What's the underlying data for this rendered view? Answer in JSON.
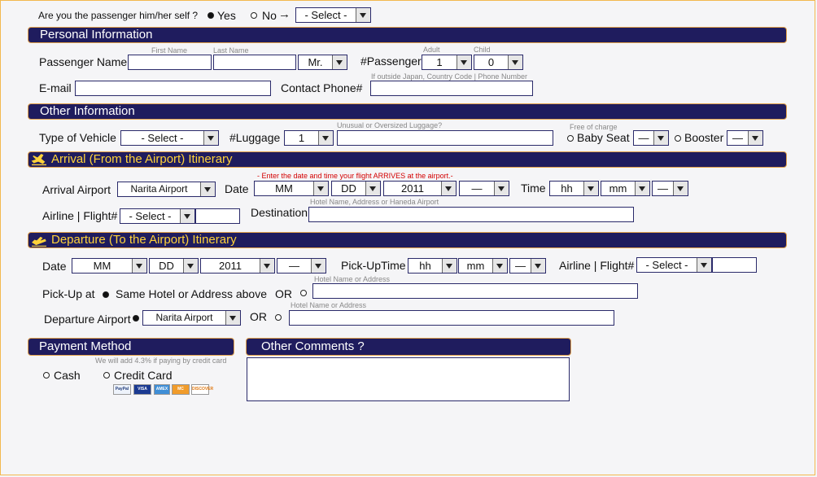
{
  "top": {
    "question": "Are you the passenger him/her self ?",
    "yes": "Yes",
    "no": "No",
    "arrow": "→",
    "select": "- Select -"
  },
  "personal": {
    "title": "Personal Information",
    "passenger_name": "Passenger Name",
    "first_name": "First Name",
    "last_name": "Last Name",
    "title_value": "Mr.",
    "num_passenger": "#Passenger",
    "adult": "Adult",
    "child": "Child",
    "adult_value": "1",
    "child_value": "0",
    "email": "E-mail",
    "contact_phone": "Contact Phone#",
    "phone_hint": "If outside Japan, Country Code | Phone Number"
  },
  "other": {
    "title": "Other Information",
    "type_vehicle": "Type of Vehicle",
    "vehicle_value": "- Select -",
    "luggage": "#Luggage",
    "luggage_value": "1",
    "luggage_hint": "Unusual or Oversized Luggage?",
    "free_charge": "Free of charge",
    "baby_seat": "Baby Seat",
    "booster": "Booster",
    "dash": "—"
  },
  "arrival": {
    "title": "Arrival (From the Airport) Itinerary",
    "airport_label": "Arrival Airport",
    "airport_value": "Narita Airport",
    "date": "Date",
    "warning": "- Enter the date and time your flight ARRIVES at the airport.-",
    "mm": "MM",
    "dd": "DD",
    "year": "2011",
    "dash": "—",
    "time": "Time",
    "hh": "hh",
    "min": "mm",
    "airline": "Airline | Flight#",
    "airline_value": "- Select -",
    "destination": "Destination",
    "dest_hint": "Hotel Name, Address or Haneda Airport"
  },
  "departure": {
    "title": "Departure (To the Airport) Itinerary",
    "date": "Date",
    "mm": "MM",
    "dd": "DD",
    "year": "2011",
    "dash": "—",
    "pickup_time": "Pick-UpTime",
    "hh": "hh",
    "min": "mm",
    "airline": "Airline | Flight#",
    "airline_value": "- Select -",
    "pickup_at": "Pick-Up at",
    "same_hotel": "Same Hotel or Address above",
    "or": "OR",
    "hotel_hint": "Hotel Name or Address",
    "dep_airport": "Departure Airport",
    "dep_airport_value": "Narita Airport"
  },
  "payment": {
    "title": "Payment Method",
    "note": "We will add 4.3% if paying by credit card",
    "cash": "Cash",
    "credit": "Credit Card",
    "cards": [
      "PayPal",
      "VISA",
      "AMEX",
      "MC",
      "DISCOVER"
    ]
  },
  "comments": {
    "title": "Other Comments ?"
  },
  "colors": {
    "bar": "#1f1c5e",
    "bar_border": "#e2a14a",
    "itinerary_text": "#ffd23a",
    "warning": "#d40000"
  }
}
